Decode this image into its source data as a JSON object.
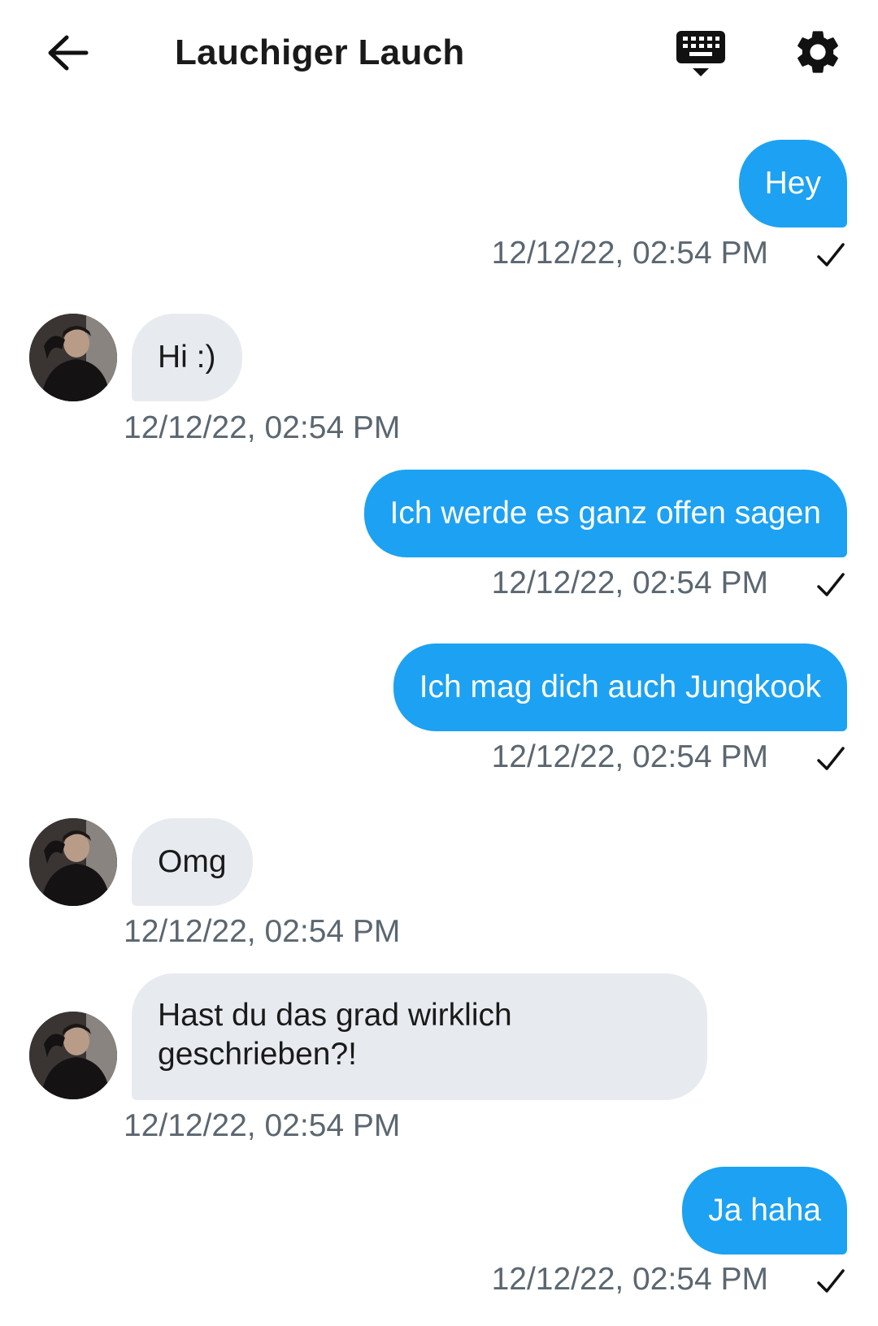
{
  "header": {
    "title": "Lauchiger Lauch",
    "back_icon": "arrow-left-icon",
    "keyboard_icon": "keyboard-hide-icon",
    "settings_icon": "gear-icon"
  },
  "colors": {
    "outgoing_bubble": "#1da1f2",
    "incoming_bubble": "#e7ebef",
    "timestamp": "#5b6770"
  },
  "messages": [
    {
      "direction": "out",
      "text": "Hey",
      "time": "12/12/22, 02:54 PM",
      "status": "sent-check-icon"
    },
    {
      "direction": "in",
      "text": "Hi :)",
      "time": "12/12/22, 02:54 PM"
    },
    {
      "direction": "out",
      "text": "Ich werde es ganz offen sagen",
      "time": "12/12/22, 02:54 PM",
      "status": "sent-check-icon"
    },
    {
      "direction": "out",
      "text": "Ich mag dich auch Jungkook",
      "time": "12/12/22, 02:54 PM",
      "status": "sent-check-icon"
    },
    {
      "direction": "in",
      "text": "Omg",
      "time": "12/12/22, 02:54 PM"
    },
    {
      "direction": "in",
      "text": "Hast du das grad wirklich geschrieben?!",
      "time": "12/12/22, 02:54 PM"
    },
    {
      "direction": "out",
      "text": "Ja haha",
      "time": "12/12/22, 02:54 PM",
      "status": "sent-check-icon"
    }
  ]
}
